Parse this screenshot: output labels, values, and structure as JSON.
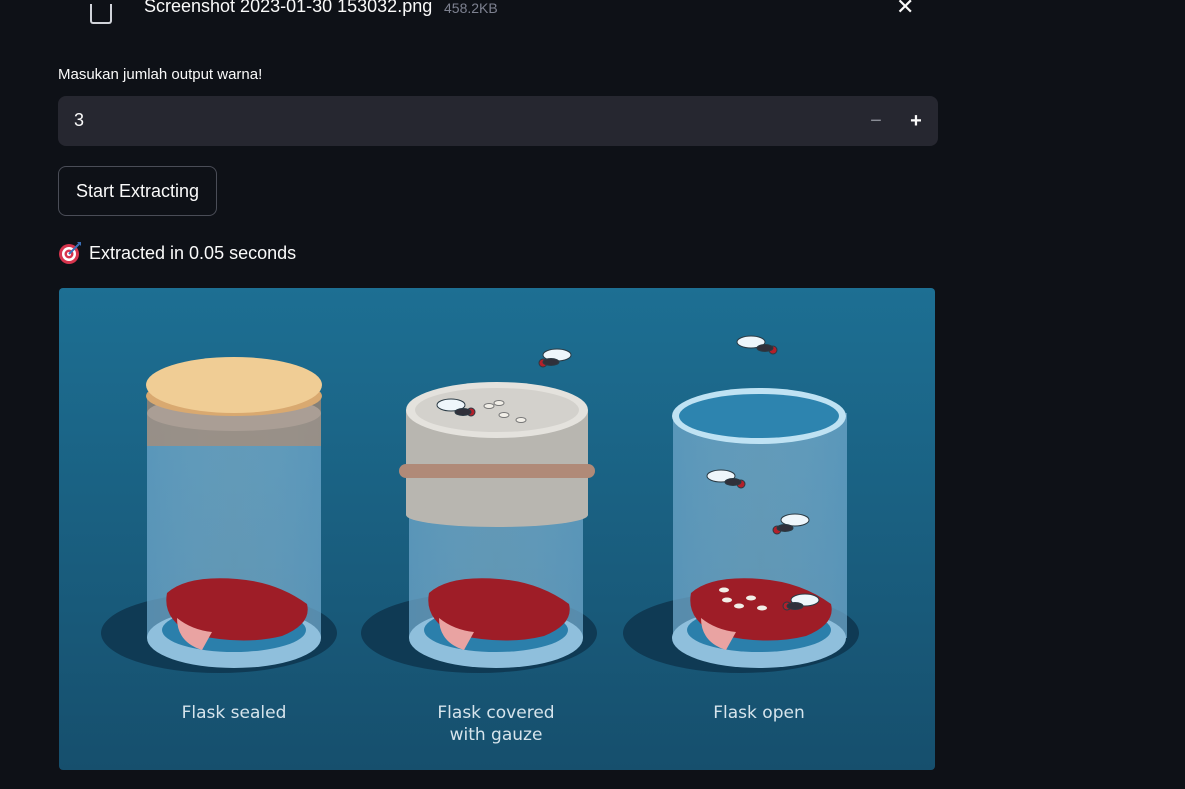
{
  "uploaded_file": {
    "name": "Screenshot 2023-01-30 153032.png",
    "size": "458.2KB",
    "icon": "file-icon",
    "remove_icon": "close-icon"
  },
  "number_input": {
    "label": "Masukan jumlah output warna!",
    "value": "3",
    "minus_label": "−",
    "plus_label": "+"
  },
  "start_button": {
    "label": "Start Extracting"
  },
  "result": {
    "icon": "target-icon",
    "text": "Extracted in 0.05 seconds"
  },
  "image": {
    "flasks": [
      {
        "caption_line1": "Flask sealed",
        "caption_line2": ""
      },
      {
        "caption_line1": "Flask covered",
        "caption_line2": "with gauze"
      },
      {
        "caption_line1": "Flask open",
        "caption_line2": ""
      }
    ],
    "colors": {
      "background_top": "#1d6f93",
      "background_bottom": "#154e6c",
      "cork": "#f0cd95",
      "gauze": "#c8c6c0",
      "meat": "#a6202a",
      "glass": "#7fb4d6"
    }
  },
  "theme": {
    "page_background": "#0e1117",
    "input_background": "#262730",
    "text": "#fafafa"
  }
}
